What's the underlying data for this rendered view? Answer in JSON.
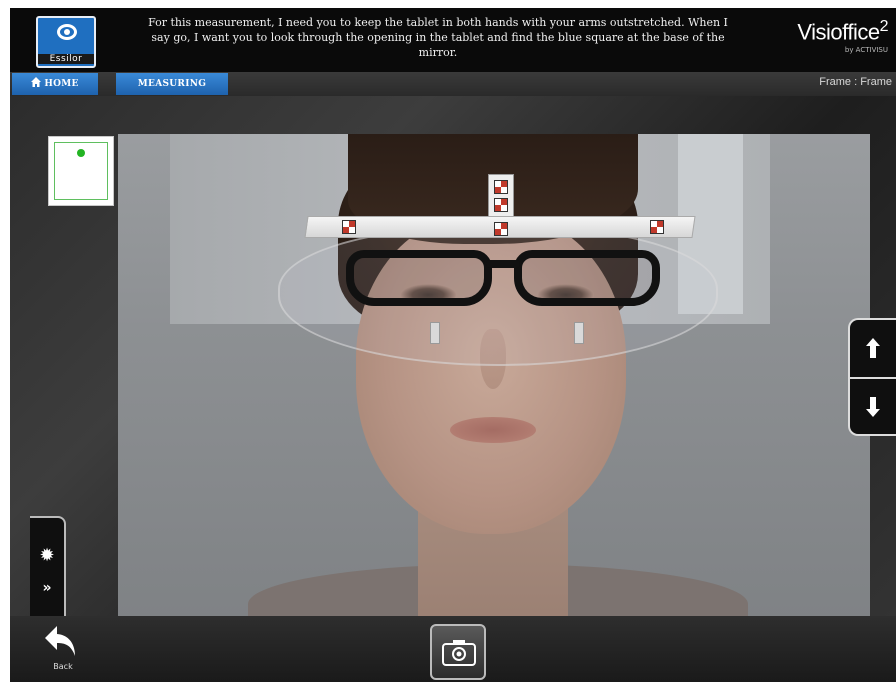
{
  "header": {
    "logo_text": "Essilor",
    "instruction": "For this measurement, I need you to keep the tablet in both hands with your arms outstretched.  When I say go, I want you to look through the opening in the tablet and find the blue square at the base of the mirror.",
    "brand_name": "Visioffice",
    "brand_version": "2",
    "brand_sub": "by ACTIVISU"
  },
  "nav": {
    "home_label": "HOME",
    "measuring_label": "MEASURING",
    "frame_label": "Frame :  Frame"
  },
  "footer": {
    "back_label": "Back"
  },
  "icons": {
    "home": "home-icon",
    "arrow_up": "arrow-up-icon",
    "arrow_down": "arrow-down-icon",
    "settings": "sun-settings-icon",
    "expand": "double-chevron-right-icon",
    "back": "back-arrow-icon",
    "camera": "camera-icon"
  },
  "colors": {
    "nav_tab": "#1e62ad",
    "logo_bg": "#1f6fc0",
    "mirror_dot": "#23b423"
  }
}
